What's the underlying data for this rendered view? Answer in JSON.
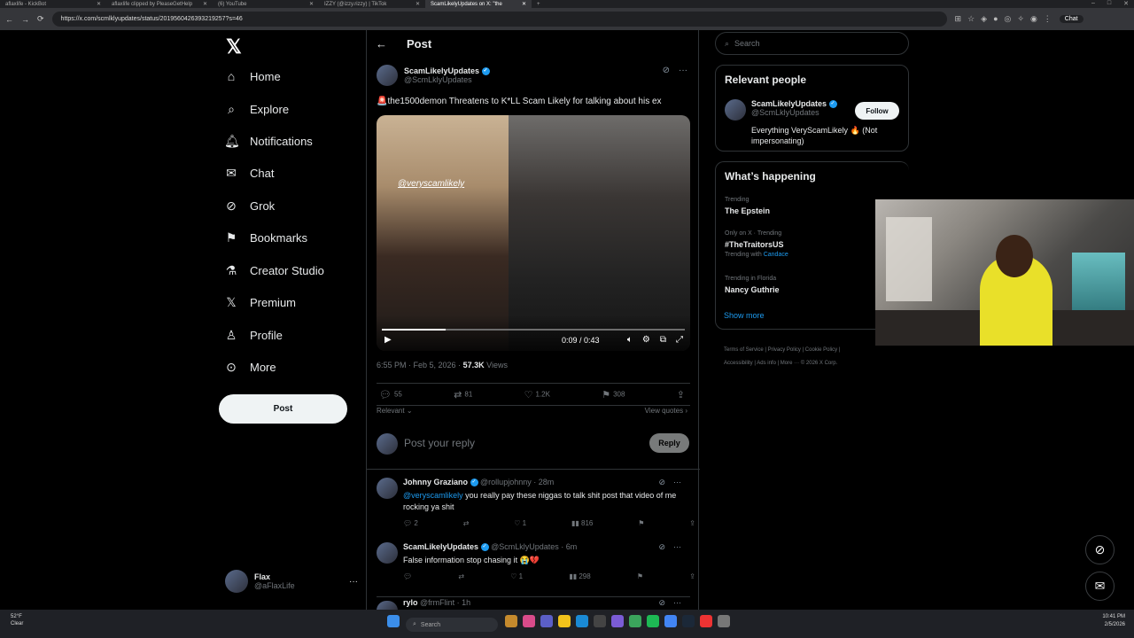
{
  "browser": {
    "tabs": [
      {
        "label": "aflaxlife - KickBot",
        "active": false
      },
      {
        "label": "aflaxlife clipped by PleaseGetHelp",
        "active": false
      },
      {
        "label": "(6) YouTube",
        "active": false
      },
      {
        "label": "IZZY (@izzy.rizzy) | TikTok",
        "active": false
      },
      {
        "label": "ScamLikelyUpdates on X: \"the",
        "active": true
      }
    ],
    "url": "https://x.com/scmlklyupdates/status/2019560426393219257?s=46",
    "chat_label": "Chat"
  },
  "sidebar": {
    "items": [
      {
        "label": "Home",
        "icon": "home-icon"
      },
      {
        "label": "Explore",
        "icon": "search-icon"
      },
      {
        "label": "Notifications",
        "icon": "bell-icon"
      },
      {
        "label": "Chat",
        "icon": "mail-icon"
      },
      {
        "label": "Grok",
        "icon": "grok-icon"
      },
      {
        "label": "Bookmarks",
        "icon": "bookmark-icon"
      },
      {
        "label": "Creator Studio",
        "icon": "flask-icon"
      },
      {
        "label": "Premium",
        "icon": "x-icon"
      },
      {
        "label": "Profile",
        "icon": "person-icon"
      },
      {
        "label": "More",
        "icon": "more-circle-icon"
      }
    ],
    "post_button": "Post",
    "account": {
      "name": "Flax",
      "handle": "@aFlaxLife"
    }
  },
  "post": {
    "header": "Post",
    "author_name": "ScamLikelyUpdates",
    "author_handle": "@ScmLklyUpdates",
    "text": "🚨the1500demon Threatens to K*LL Scam Likely for talking about his ex",
    "video": {
      "watermark": "@veryscamlikely",
      "time": "0:09 / 0:43",
      "progress": 0.21
    },
    "timestamp": "6:55 PM · Feb 5, 2026 ·",
    "views_count": "57.3K",
    "views_label": "Views",
    "stats": {
      "replies": "55",
      "reposts": "81",
      "likes": "1.2K",
      "bookmarks": "308"
    },
    "relevant": "Relevant",
    "view_quotes": "View quotes",
    "reply_placeholder": "Post your reply",
    "reply_button": "Reply"
  },
  "comments": [
    {
      "name": "Johnny Graziano",
      "handle": "@rollupjohnny · 28m",
      "mention": "@veryscamlikely",
      "text": " you really pay these niggas to talk shit post that video of me rocking ya shit",
      "replies": "2",
      "reposts": "",
      "likes": "1",
      "views": "816"
    },
    {
      "name": "ScamLikelyUpdates",
      "handle": "@ScmLklyUpdates · 6m",
      "mention": "",
      "text": "False information stop chasing it 😭💔",
      "replies": "",
      "reposts": "",
      "likes": "1",
      "views": "298"
    },
    {
      "name": "rylo",
      "handle": "@frmFlint · 1h"
    }
  ],
  "right": {
    "search_placeholder": "Search",
    "relevant_title": "Relevant people",
    "person": {
      "name": "ScamLikelyUpdates",
      "handle": "@ScmLklyUpdates",
      "follow": "Follow",
      "bio": "Everything VeryScamLikely 🔥 (Not impersonating)"
    },
    "happening_title": "What’s happening",
    "trends": [
      {
        "context": "Trending",
        "name": "The Epstein",
        "extra": ""
      },
      {
        "context": "Only on X · Trending",
        "name": "#TheTraitorsUS",
        "extra_prefix": "Trending with",
        "extra": "Candace"
      },
      {
        "context": "Trending in Florida",
        "name": "Nancy Guthrie",
        "extra": ""
      }
    ],
    "show_more": "Show more",
    "footer_line1": "Terms of Service  |  Privacy Policy  |  Cookie Policy  |",
    "footer_line2": "Accessibility  |  Ads info  |  More ···  © 2026 X Corp."
  },
  "taskbar": {
    "weather_temp": "52°F",
    "weather_desc": "Clear",
    "search": "Search",
    "time": "10:41 PM",
    "date": "2/5/2026"
  },
  "colors": {
    "accent": "#1d9bf0",
    "background": "#000000",
    "border": "#2f3336",
    "muted": "#71767b"
  }
}
